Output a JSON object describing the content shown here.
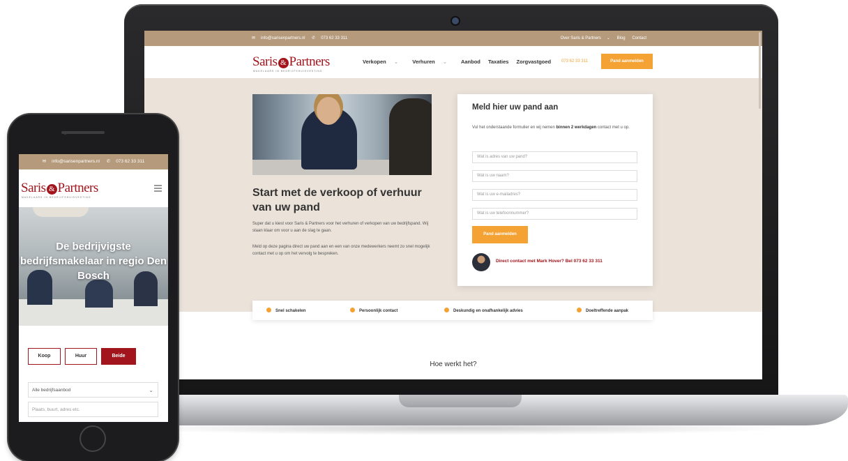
{
  "brand": {
    "name_left": "Saris",
    "name_right": "Partners",
    "logo_mark": "&",
    "tagline": "MAKELAARS IN BEDRIJFSHUISVESTING",
    "accent_color": "#f5a234",
    "brand_color": "#a2151c"
  },
  "desktop": {
    "topbar": {
      "email": "info@sarisenpartners.nl",
      "phone": "073 62 33 311",
      "links": [
        "Over Saris & Partners",
        "Blog",
        "Contact"
      ]
    },
    "nav": {
      "items": [
        "Verkopen",
        "Verhuren",
        "Aanbod",
        "Taxaties",
        "Zorgvastgoed"
      ],
      "phone": "073 62 33 311",
      "cta": "Pand aanmelden"
    },
    "hero": {
      "title": "Start met de verkoop of verhuur van uw pand",
      "paragraph1": "Super dat u kiest voor Saris & Partners voor het verhuren of verkopen van uw bedrijfspand. Wij staan klaar om voor u aan de slag te gaan.",
      "paragraph2": "Meld op deze pagina direct uw pand aan en een van onze medewerkers neemt zo snel mogelijk contact met u op om het vervolg te bespreken."
    },
    "form": {
      "title": "Meld hier uw pand aan",
      "desc_before": "Vul het onderstaande formulier en wij nemen ",
      "desc_bold": "binnen 2 werkdagen",
      "desc_after": " contact met u op.",
      "placeholders": [
        "Wat is adres van uw pand?",
        "Wat is uw naam?",
        "Wat is uw e-mailadres?",
        "Wat is uw telefoonnummer?"
      ],
      "submit": "Pand aanmelden",
      "contact": "Direct contact met Mark Hover? Bel 073 62 33 311"
    },
    "features": [
      "Snel schakelen",
      "Persoonlijk contact",
      "Deskundig en onafhankelijk advies",
      "Doeltreffende aanpak"
    ],
    "section_title": "Hoe werkt het?"
  },
  "mobile": {
    "topbar": {
      "email": "info@sarisenpartners.nl",
      "phone": "073 62 33 311"
    },
    "hero_title": "De bedrijvigste bedrijfsmakelaar in regio Den Bosch",
    "segments": [
      "Koop",
      "Huur",
      "Beide"
    ],
    "select_value": "Alle bedrijfsaanbod",
    "search_placeholder": "Plaats, buurt, adres etc."
  }
}
